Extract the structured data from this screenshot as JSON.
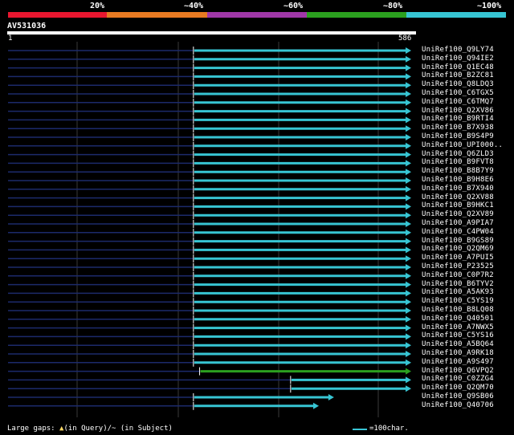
{
  "query": {
    "name": "AV531036",
    "start": "1",
    "end": "586"
  },
  "legend": {
    "colors": [
      "#e8162f",
      "#e77a22",
      "#a038a8",
      "#2ba01f",
      "#37c5d3"
    ],
    "labels": [
      "20%",
      "~40%",
      "~60%",
      "~80%",
      "~100%"
    ]
  },
  "hits": [
    {
      "name": "UniRef100_Q9LY74",
      "start": 270,
      "end": 586,
      "color": "#37c5d3"
    },
    {
      "name": "UniRef100_Q94IE2",
      "start": 270,
      "end": 586,
      "color": "#37c5d3"
    },
    {
      "name": "UniRef100_Q1EC48",
      "start": 270,
      "end": 586,
      "color": "#37c5d3"
    },
    {
      "name": "UniRef100_B2ZC81",
      "start": 270,
      "end": 586,
      "color": "#37c5d3"
    },
    {
      "name": "UniRef100_Q8LDQ3",
      "start": 270,
      "end": 586,
      "color": "#37c5d3"
    },
    {
      "name": "UniRef100_C6TGX5",
      "start": 270,
      "end": 586,
      "color": "#37c5d3"
    },
    {
      "name": "UniRef100_C6TMQ7",
      "start": 270,
      "end": 586,
      "color": "#37c5d3"
    },
    {
      "name": "UniRef100_Q2XV86",
      "start": 270,
      "end": 586,
      "color": "#37c5d3"
    },
    {
      "name": "UniRef100_B9RTI4",
      "start": 270,
      "end": 586,
      "color": "#37c5d3"
    },
    {
      "name": "UniRef100_B7X938",
      "start": 270,
      "end": 586,
      "color": "#37c5d3"
    },
    {
      "name": "UniRef100_B9S4P9",
      "start": 270,
      "end": 586,
      "color": "#37c5d3"
    },
    {
      "name": "UniRef100_UPI000..",
      "start": 270,
      "end": 586,
      "color": "#37c5d3"
    },
    {
      "name": "UniRef100_Q6ZLD3",
      "start": 270,
      "end": 586,
      "color": "#37c5d3"
    },
    {
      "name": "UniRef100_B9FVT8",
      "start": 270,
      "end": 586,
      "color": "#37c5d3"
    },
    {
      "name": "UniRef100_B8B7Y9",
      "start": 270,
      "end": 586,
      "color": "#37c5d3"
    },
    {
      "name": "UniRef100_B9H8E6",
      "start": 270,
      "end": 586,
      "color": "#37c5d3"
    },
    {
      "name": "UniRef100_B7X940",
      "start": 270,
      "end": 586,
      "color": "#37c5d3"
    },
    {
      "name": "UniRef100_Q2XV88",
      "start": 270,
      "end": 586,
      "color": "#37c5d3"
    },
    {
      "name": "UniRef100_B9HKC1",
      "start": 270,
      "end": 586,
      "color": "#37c5d3"
    },
    {
      "name": "UniRef100_Q2XV89",
      "start": 270,
      "end": 586,
      "color": "#37c5d3"
    },
    {
      "name": "UniRef100_A9PIA7",
      "start": 270,
      "end": 586,
      "color": "#37c5d3"
    },
    {
      "name": "UniRef100_C4PW04",
      "start": 270,
      "end": 586,
      "color": "#37c5d3"
    },
    {
      "name": "UniRef100_B9GS89",
      "start": 270,
      "end": 586,
      "color": "#37c5d3"
    },
    {
      "name": "UniRef100_Q2QM69",
      "start": 270,
      "end": 586,
      "color": "#37c5d3"
    },
    {
      "name": "UniRef100_A7PUI5",
      "start": 270,
      "end": 586,
      "color": "#37c5d3"
    },
    {
      "name": "UniRef100_P23525",
      "start": 270,
      "end": 586,
      "color": "#37c5d3"
    },
    {
      "name": "UniRef100_C0P7R2",
      "start": 270,
      "end": 586,
      "color": "#37c5d3"
    },
    {
      "name": "UniRef100_B6TYV2",
      "start": 270,
      "end": 586,
      "color": "#37c5d3"
    },
    {
      "name": "UniRef100_A5AK93",
      "start": 270,
      "end": 586,
      "color": "#37c5d3"
    },
    {
      "name": "UniRef100_C5YS19",
      "start": 270,
      "end": 586,
      "color": "#37c5d3"
    },
    {
      "name": "UniRef100_B8LQ08",
      "start": 270,
      "end": 586,
      "color": "#37c5d3"
    },
    {
      "name": "UniRef100_Q40501",
      "start": 270,
      "end": 586,
      "color": "#37c5d3"
    },
    {
      "name": "UniRef100_A7NWX5",
      "start": 270,
      "end": 586,
      "color": "#37c5d3"
    },
    {
      "name": "UniRef100_C5YS16",
      "start": 270,
      "end": 586,
      "color": "#37c5d3"
    },
    {
      "name": "UniRef100_A5BQ64",
      "start": 270,
      "end": 586,
      "color": "#37c5d3"
    },
    {
      "name": "UniRef100_A9RK18",
      "start": 270,
      "end": 586,
      "color": "#37c5d3"
    },
    {
      "name": "UniRef100_A9S497",
      "start": 270,
      "end": 586,
      "color": "#37c5d3"
    },
    {
      "name": "UniRef100_Q6VPQ2",
      "start": 279,
      "end": 586,
      "color": "#2ba01f"
    },
    {
      "name": "UniRef100_C0ZZG4",
      "start": 411,
      "end": 586,
      "color": "#37c5d3"
    },
    {
      "name": "UniRef100_Q2QM70",
      "start": 411,
      "end": 586,
      "color": "#37c5d3"
    },
    {
      "name": "UniRef100_Q9SB06",
      "start": 270,
      "end": 474,
      "color": "#37c5d3"
    },
    {
      "name": "UniRef100_Q40706",
      "start": 270,
      "end": 452,
      "color": "#37c5d3"
    }
  ],
  "footer": {
    "large_gaps": "Large gaps:",
    "in_query": "(in Query)/~ (in Subject)",
    "scale": "=100char."
  }
}
